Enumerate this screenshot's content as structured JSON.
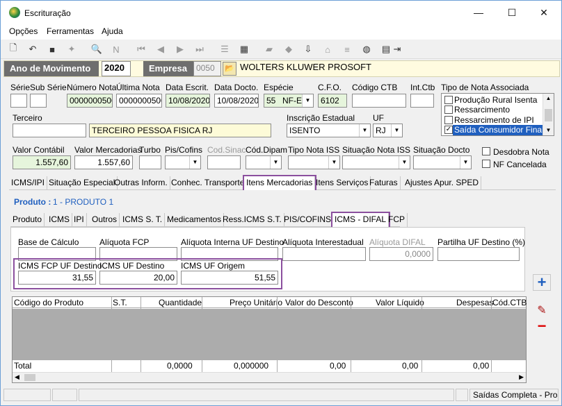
{
  "window": {
    "title": "Escrituração",
    "minimize": "—",
    "maximize": "☐",
    "close": "✕"
  },
  "menu": {
    "items": [
      "Opções",
      "Ferramentas",
      "Ajuda"
    ]
  },
  "yearbar": {
    "ano_label": "Ano de Movimento",
    "ano_value": "2020",
    "empresa_label": "Empresa",
    "empresa_code": "0050",
    "empresa_name": "WOLTERS KLUWER PROSOFT"
  },
  "header": {
    "serie_label": "Série",
    "subserie_label": "Sub Série",
    "numero_label": "Número Nota",
    "numero_value": "0000000500",
    "ultima_label": "Última Nota",
    "ultima_value": "0000000500",
    "data_escrit_label": "Data Escrit.",
    "data_escrit_value": "10/08/2020",
    "data_docto_label": "Data Docto.",
    "data_docto_value": "10/08/2020",
    "especie_label": "Espécie",
    "especie_code": "55",
    "especie_value": "NF-E",
    "cfo_label": "C.F.O.",
    "cfo_value": "6102",
    "codigo_ctb_label": "Código CTB",
    "int_ctb_label": "Int.Ctb",
    "tipo_nota_label": "Tipo de Nota Associada",
    "tipo_nota_options": [
      {
        "label": "Produção Rural Isenta",
        "checked": false,
        "selected": false
      },
      {
        "label": "Ressarcimento",
        "checked": false,
        "selected": false
      },
      {
        "label": "Ressarcimento de IPI",
        "checked": false,
        "selected": false
      },
      {
        "label": "Saída Consumidor Final",
        "checked": true,
        "selected": true
      }
    ],
    "terceiro_label": "Terceiro",
    "terceiro_value": "TERCEIRO PESSOA FISICA RJ",
    "ie_label": "Inscrição Estadual",
    "ie_value": "ISENTO",
    "uf_label": "UF",
    "uf_value": "RJ",
    "valor_contabil_label": "Valor Contábil",
    "valor_contabil_value": "1.557,60",
    "valor_merc_label": "Valor Mercadorias",
    "valor_merc_value": "1.557,60",
    "turbo_label": "Turbo",
    "pis_label": "Pis/Cofins",
    "cod_sinac_label": "Cod.Sinac",
    "cod_dipam_label": "Cód.Dipam",
    "tipo_iss_label": "Tipo Nota ISS",
    "situacao_iss_label": "Situação Nota ISS",
    "situacao_docto_label": "Situação Docto",
    "desdobra_label": "Desdobra Nota",
    "nf_cancelada_label": "NF Cancelada"
  },
  "main_tabs": [
    "ICMS/IPI",
    "Situação Especial",
    "Outras Inform.",
    "Conhec. Transporte",
    "Itens Mercadorias",
    "Itens Serviços",
    "Faturas",
    "Ajustes Apur. SPED"
  ],
  "produto": {
    "label": "Produto :",
    "value": "1 - PRODUTO 1"
  },
  "sub_tabs": [
    "Produto",
    "ICMS",
    "IPI",
    "Outros",
    "ICMS S. T.",
    "Medicamentos",
    "Ress.ICMS S.T.",
    "PIS/COFINS",
    "ICMS - DIFAL",
    "FCP"
  ],
  "difal": {
    "base_label": "Base de Cálculo",
    "aliq_fcp_label": "Alíquota FCP",
    "aliq_interna_label": "Alíquota Interna UF Destino",
    "aliq_inter_label": "Alíquota Interestadual",
    "aliq_difal_label": "Alíquota DIFAL",
    "aliq_difal_value": "0,0000",
    "partilha_label": "Partilha UF Destino (%)",
    "icms_fcp_label": "ICMS FCP UF Destino",
    "icms_fcp_value": "31,55",
    "icms_dest_label": "ICMS UF Destino",
    "icms_dest_value": "20,00",
    "icms_orig_label": "ICMS UF Origem",
    "icms_orig_value": "51,55"
  },
  "grid": {
    "columns": [
      "Código do Produto",
      "S.T.",
      "Quantidade",
      "Preço Unitário",
      "Valor do Desconto",
      "Valor Líquido",
      "Despesas",
      "Cód.CTB"
    ],
    "total_label": "Total",
    "totals": [
      "0,0000",
      "0,000000",
      "0,00",
      "0,00",
      "0,00"
    ]
  },
  "status": {
    "text": "Saídas Completa - Pros"
  },
  "colors": {
    "accent": "#1f5fbf",
    "highlight": "#8b4f9e",
    "dark_label": "#6e6e6e"
  }
}
